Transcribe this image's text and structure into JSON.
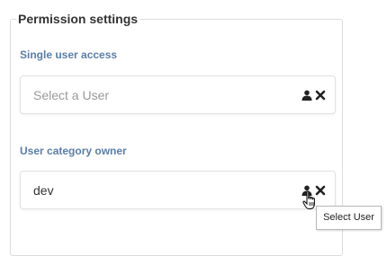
{
  "permission_settings": {
    "legend": "Permission settings",
    "single_user_access": {
      "label": "Single user access",
      "placeholder": "Select a User",
      "value": "",
      "select_icon": "user-icon",
      "clear_icon": "close-icon"
    },
    "user_category_owner": {
      "label": "User category owner",
      "value": "dev",
      "select_icon": "user-icon",
      "clear_icon": "close-icon"
    }
  },
  "tooltip": {
    "text": "Select User"
  },
  "cursor": {
    "type": "hand-pointer"
  },
  "colors": {
    "label": "#5a7ea6",
    "legend": "#333333",
    "placeholder": "#9a9a9a",
    "border": "#e2e2e2",
    "icon": "#222222"
  }
}
